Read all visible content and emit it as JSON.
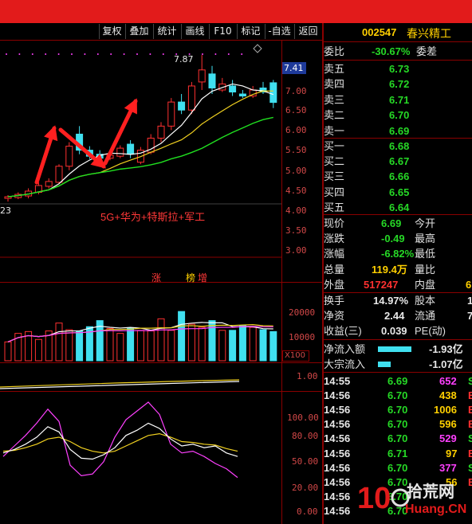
{
  "toolbar": {
    "buttons": [
      "复权",
      "叠加",
      "统计",
      "画线",
      "F10",
      "标记",
      "-自选",
      "返回"
    ]
  },
  "kline": {
    "top_marker": "7.87",
    "left_value": "23",
    "price_tag": "7.41",
    "y_ticks": [
      "7.00",
      "6.50",
      "6.00",
      "5.50",
      "5.00",
      "4.50",
      "4.00",
      "3.50",
      "3.00"
    ],
    "annotation": "5G+华为+特斯拉+军工",
    "badge_1": "涨",
    "badge_2": "榜",
    "badge_3": "增"
  },
  "volume": {
    "y_ticks": [
      "20000",
      "10000"
    ],
    "unit": "X100",
    "bars": [
      6200,
      9000,
      9600,
      7000,
      9800,
      12400,
      10200,
      9800,
      11200,
      13200,
      10600,
      9000,
      10800,
      10000,
      9800,
      13800,
      10000,
      16200,
      12000,
      11000,
      13200,
      10000,
      10000,
      11600,
      11000,
      10200,
      9600
    ]
  },
  "macd": {
    "y_ticks": [
      "1.00"
    ]
  },
  "kdj": {
    "y_ticks": [
      "100.00",
      "80.00",
      "50.00",
      "20.00",
      "0.00"
    ]
  },
  "quote": {
    "code": "002547",
    "name": "春兴精工",
    "weibi_label": "委比",
    "weibi_value": "-30.67%",
    "weicha_label": "委差",
    "asks": [
      {
        "label": "卖五",
        "price": "6.73"
      },
      {
        "label": "卖四",
        "price": "6.72"
      },
      {
        "label": "卖三",
        "price": "6.71"
      },
      {
        "label": "卖二",
        "price": "6.70"
      },
      {
        "label": "卖一",
        "price": "6.69"
      }
    ],
    "bids": [
      {
        "label": "买一",
        "price": "6.68"
      },
      {
        "label": "买二",
        "price": "6.67"
      },
      {
        "label": "买三",
        "price": "6.66"
      },
      {
        "label": "买四",
        "price": "6.65"
      },
      {
        "label": "买五",
        "price": "6.64"
      }
    ],
    "stats": [
      {
        "label": "现价",
        "value": "6.69",
        "label2": "今开",
        "value2": ""
      },
      {
        "label": "涨跌",
        "value": "-0.49",
        "label2": "最高",
        "value2": ""
      },
      {
        "label": "涨幅",
        "value": "-6.82%",
        "label2": "最低",
        "value2": ""
      },
      {
        "label": "总量",
        "value": "119.4万",
        "label2": "量比",
        "value2": ""
      },
      {
        "label": "外盘",
        "value": "517247",
        "label2": "内盘",
        "value2": "6"
      }
    ],
    "fin": [
      {
        "label": "换手",
        "value": "14.97%",
        "label2": "股本",
        "value2": "1"
      },
      {
        "label": "净资",
        "value": "2.44",
        "label2": "流通",
        "value2": "7"
      },
      {
        "label": "收益(三)",
        "value": "0.039",
        "label2": "PE(动)",
        "value2": ""
      }
    ],
    "flow": [
      {
        "label": "净流入额",
        "value": "-1.93亿",
        "bar": 0.8
      },
      {
        "label": "大宗流入",
        "value": "-1.07亿",
        "bar": 0.3
      }
    ],
    "ticks": [
      {
        "time": "14:55",
        "price": "6.69",
        "vol": "652",
        "flag": "S"
      },
      {
        "time": "14:56",
        "price": "6.70",
        "vol": "438",
        "flag": "B"
      },
      {
        "time": "14:56",
        "price": "6.70",
        "vol": "1006",
        "flag": "B"
      },
      {
        "time": "14:56",
        "price": "6.70",
        "vol": "596",
        "flag": "B"
      },
      {
        "time": "14:56",
        "price": "6.70",
        "vol": "529",
        "flag": "S"
      },
      {
        "time": "14:56",
        "price": "6.71",
        "vol": "97",
        "flag": "B"
      },
      {
        "time": "14:56",
        "price": "6.70",
        "vol": "377",
        "flag": "S"
      },
      {
        "time": "14:56",
        "price": "6.70",
        "vol": "56",
        "flag": "B"
      },
      {
        "time": "14:56",
        "price": "6.70",
        "vol": "",
        "flag": ""
      },
      {
        "time": "14:56",
        "price": "6.70",
        "vol": "",
        "flag": ""
      }
    ]
  },
  "watermark": {
    "brand": "10",
    "text_cn": "拾荒网",
    "text_en": "Huang.CN"
  },
  "colors": {
    "accent_red": "#e21b1b",
    "up_cyan": "#40e0f0",
    "down_red": "#ff3030",
    "price_green": "#26d826",
    "code_yellow": "#ffd000"
  }
}
